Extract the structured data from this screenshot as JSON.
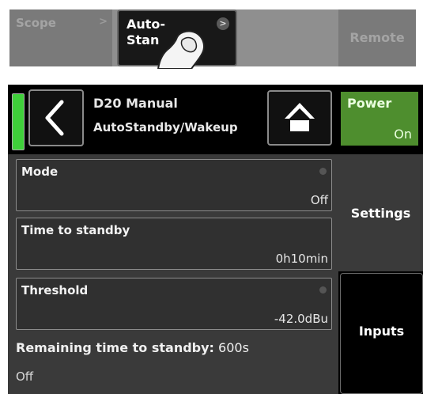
{
  "top_strip": {
    "scope_label": "Scope",
    "scope_chevron": ">",
    "auto_label_1": "Auto-",
    "auto_label_2": "Stan",
    "auto_chevron": ">",
    "remote_label": "Remote",
    "hand_icon": "pointing-hand-icon"
  },
  "header": {
    "led_color": "#3fcf3a",
    "back_icon": "chevron-left-icon",
    "device_name": "D20 Manual",
    "page_name": "AutoStandby/Wakeup",
    "home_icon": "home-icon",
    "power_label": "Power",
    "power_state": "On",
    "power_color": "#4e8e2e"
  },
  "fields": [
    {
      "label": "Mode",
      "value": "Off"
    },
    {
      "label": "Time to standby",
      "value": "0h10min"
    },
    {
      "label": "Threshold",
      "value": "-42.0dBu"
    }
  ],
  "remaining": {
    "label": "Remaining time to standby:",
    "value": "600s"
  },
  "status": "Off",
  "tabs": {
    "settings": "Settings",
    "inputs": "Inputs"
  }
}
